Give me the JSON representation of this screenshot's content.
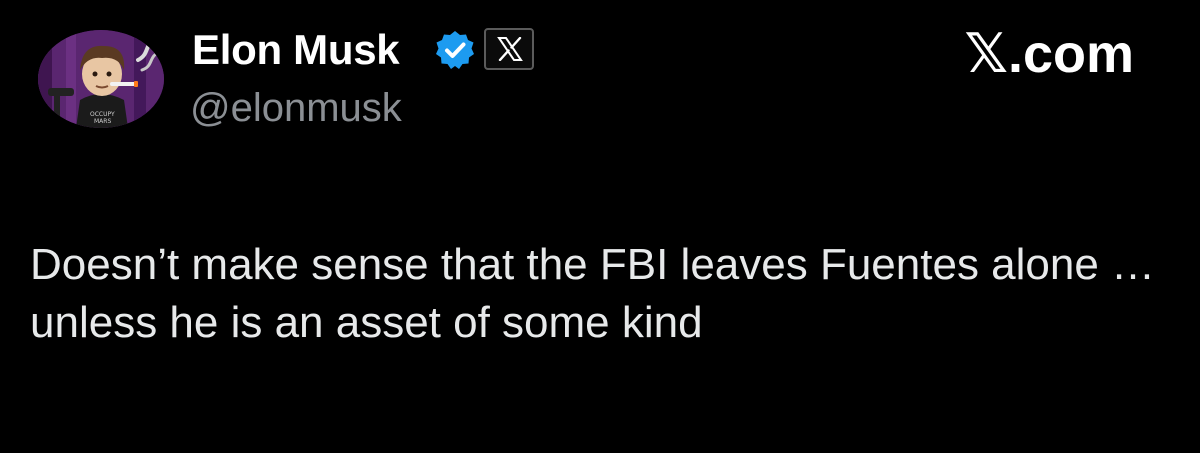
{
  "tweet": {
    "author": {
      "display_name": "Elon Musk",
      "handle": "@elonmusk",
      "verified_badge_icon": "verified-check-icon",
      "verified_color": "#1d9bf0",
      "affiliate_badge_icon": "x-logo-icon"
    },
    "brand": "𝕏.com",
    "text": "Doesn’t make sense that the FBI leaves Fuentes alone … unless he is an asset of some kind"
  },
  "colors": {
    "background": "#000000",
    "name": "#ffffff",
    "handle": "#8b8f94",
    "body": "#e7e9ea"
  }
}
